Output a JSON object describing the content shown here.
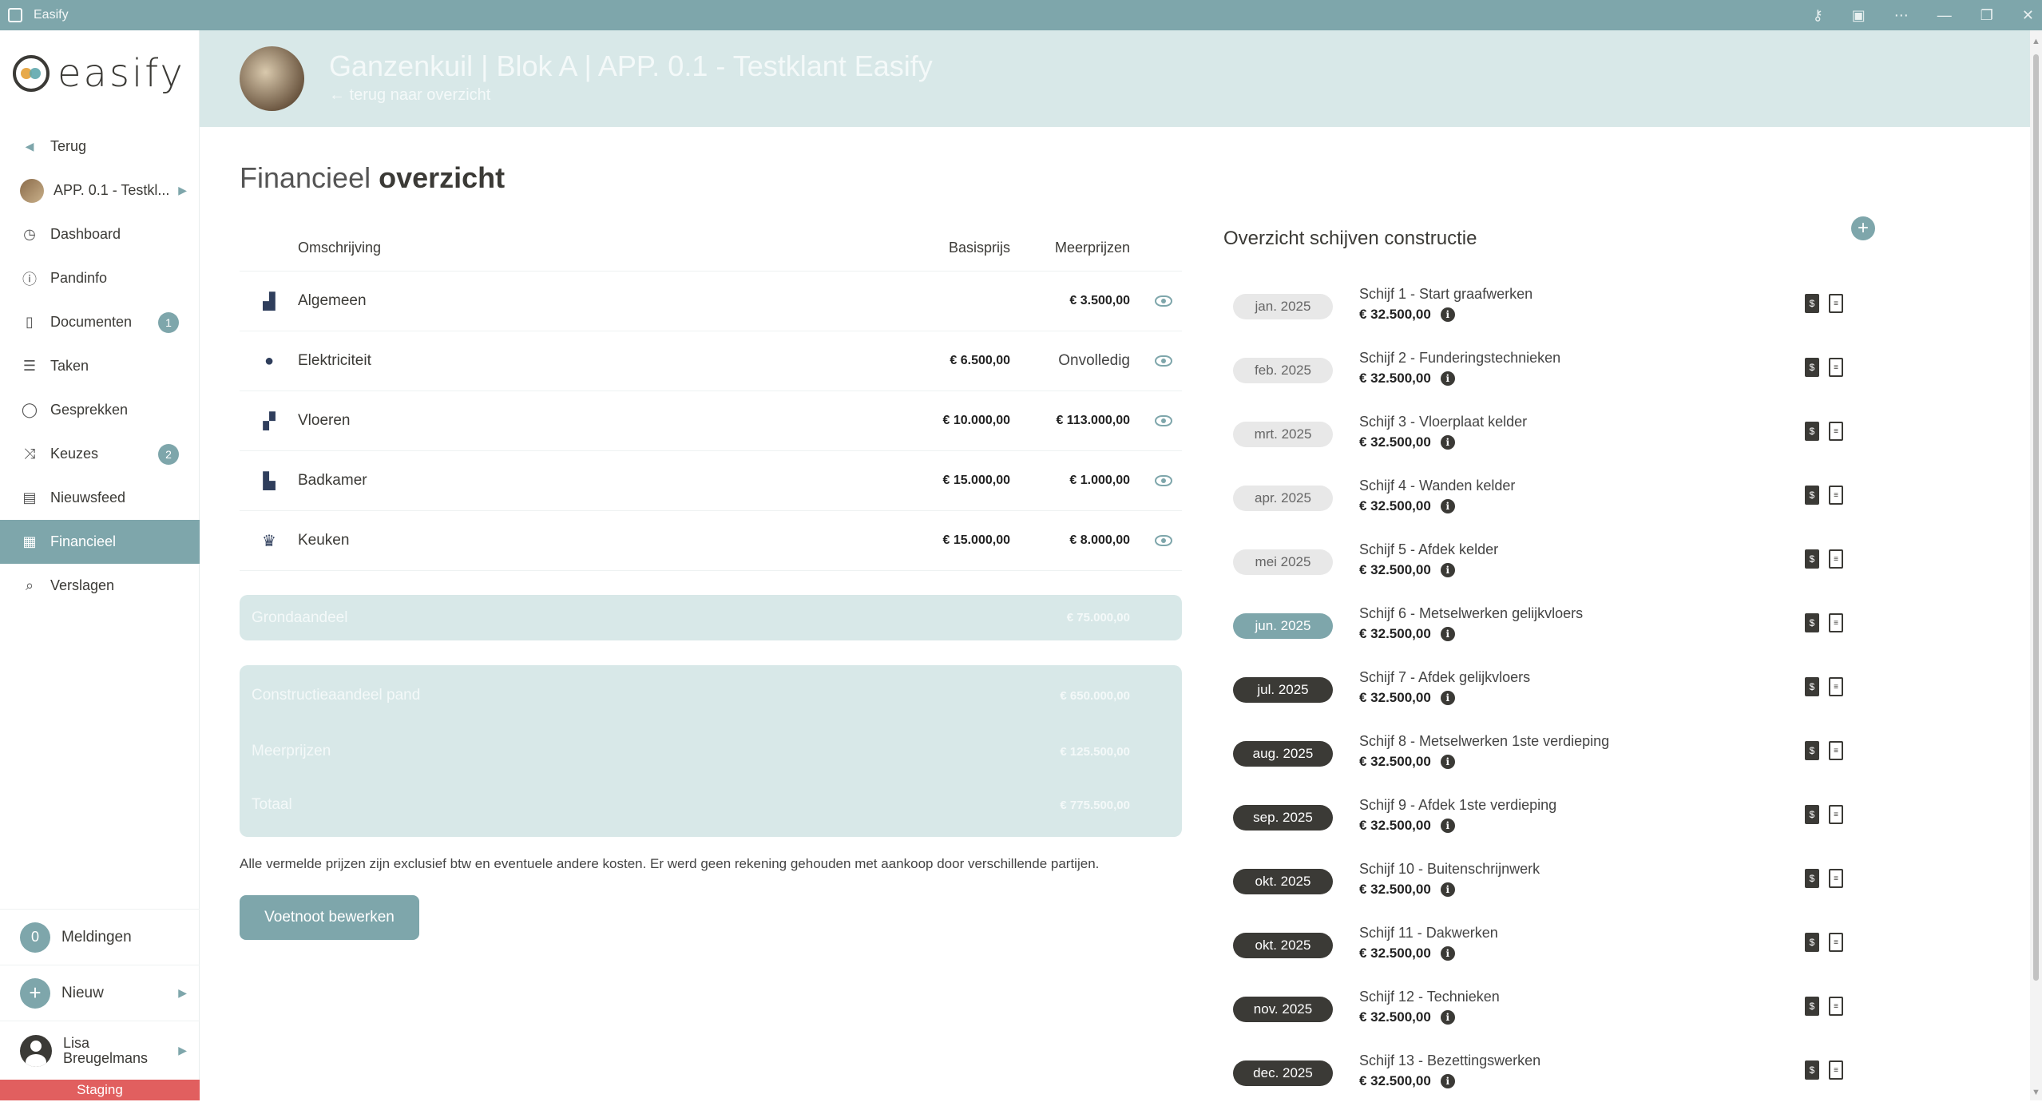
{
  "window": {
    "title": "Easify"
  },
  "sidebar": {
    "logo_text": "easify",
    "items": [
      {
        "label": "Terug",
        "icon": "caret-left-icon"
      },
      {
        "label": "APP. 0.1 - Testkl...",
        "icon": "project-avatar"
      },
      {
        "label": "Dashboard",
        "icon": "dashboard-icon"
      },
      {
        "label": "Pandinfo",
        "icon": "info-icon"
      },
      {
        "label": "Documenten",
        "icon": "document-icon",
        "badge": "1"
      },
      {
        "label": "Taken",
        "icon": "tasks-icon"
      },
      {
        "label": "Gesprekken",
        "icon": "chat-icon"
      },
      {
        "label": "Keuzes",
        "icon": "shuffle-icon",
        "badge": "2"
      },
      {
        "label": "Nieuwsfeed",
        "icon": "newsfeed-icon"
      },
      {
        "label": "Financieel",
        "icon": "finance-icon",
        "active": true
      },
      {
        "label": "Verslagen",
        "icon": "report-icon"
      }
    ],
    "notifications": {
      "count": "0",
      "label": "Meldingen"
    },
    "new": {
      "icon": "+",
      "label": "Nieuw"
    },
    "user": {
      "first": "Lisa",
      "last": "Breugelmans"
    },
    "environment": "Staging"
  },
  "header": {
    "title": "Ganzenkuil | Blok A | APP. 0.1 - Testklant Easify",
    "back_link": "← terug naar overzicht"
  },
  "page": {
    "title_light": "Financieel",
    "title_bold": "overzicht"
  },
  "fin_table": {
    "headers": {
      "description": "Omschrijving",
      "base": "Basisprijs",
      "extra": "Meerprijzen"
    },
    "rows": [
      {
        "icon": "building-icon",
        "description": "Algemeen",
        "base": "",
        "extra": "€ 3.500,00"
      },
      {
        "icon": "lightbulb-icon",
        "description": "Elektriciteit",
        "base": "€ 6.500,00",
        "extra": "Onvolledig"
      },
      {
        "icon": "floor-tiles-icon",
        "description": "Vloeren",
        "base": "€ 10.000,00",
        "extra": "€ 113.000,00"
      },
      {
        "icon": "bathtub-icon",
        "description": "Badkamer",
        "base": "€ 15.000,00",
        "extra": "€ 1.000,00"
      },
      {
        "icon": "chef-hat-icon",
        "description": "Keuken",
        "base": "€ 15.000,00",
        "extra": "€ 8.000,00"
      }
    ]
  },
  "summary": {
    "grond": {
      "label": "Grondaandeel",
      "value": "€ 75.000,00"
    },
    "constructie": {
      "label": "Constructieaandeel pand",
      "value": "€ 650.000,00"
    },
    "meerprijzen": {
      "label": "Meerprijzen",
      "value": "€ 125.500,00"
    },
    "totaal": {
      "label": "Totaal",
      "value": "€ 775.500,00"
    }
  },
  "footnote": "Alle vermelde prijzen zijn exclusief btw en eventuele andere kosten. Er werd geen rekening gehouden met aankoop door verschillende partijen.",
  "footnote_button": "Voetnoot bewerken",
  "schijven": {
    "title": "Overzicht schijven constructie",
    "add_icon": "+",
    "items": [
      {
        "date": "jan. 2025",
        "name": "Schijf 1 - Start graafwerken",
        "amount": "€ 32.500,00",
        "state": "past"
      },
      {
        "date": "feb. 2025",
        "name": "Schijf 2 - Funderingstechnieken",
        "amount": "€ 32.500,00",
        "state": "past"
      },
      {
        "date": "mrt. 2025",
        "name": "Schijf 3 - Vloerplaat kelder",
        "amount": "€ 32.500,00",
        "state": "past"
      },
      {
        "date": "apr. 2025",
        "name": "Schijf 4 - Wanden kelder",
        "amount": "€ 32.500,00",
        "state": "past"
      },
      {
        "date": "mei 2025",
        "name": "Schijf 5 - Afdek kelder",
        "amount": "€ 32.500,00",
        "state": "past"
      },
      {
        "date": "jun. 2025",
        "name": "Schijf 6 - Metselwerken gelijkvloers",
        "amount": "€ 32.500,00",
        "state": "current"
      },
      {
        "date": "jul. 2025",
        "name": "Schijf 7 - Afdek gelijkvloers",
        "amount": "€ 32.500,00",
        "state": "future"
      },
      {
        "date": "aug. 2025",
        "name": "Schijf 8 - Metselwerken 1ste verdieping",
        "amount": "€ 32.500,00",
        "state": "future"
      },
      {
        "date": "sep. 2025",
        "name": "Schijf 9 - Afdek 1ste verdieping",
        "amount": "€ 32.500,00",
        "state": "future"
      },
      {
        "date": "okt. 2025",
        "name": "Schijf 10 - Buitenschrijnwerk",
        "amount": "€ 32.500,00",
        "state": "future"
      },
      {
        "date": "okt. 2025",
        "name": "Schijf 11 - Dakwerken",
        "amount": "€ 32.500,00",
        "state": "future"
      },
      {
        "date": "nov. 2025",
        "name": "Schijf 12 - Technieken",
        "amount": "€ 32.500,00",
        "state": "future"
      },
      {
        "date": "dec. 2025",
        "name": "Schijf 13 - Bezettingswerken",
        "amount": "€ 32.500,00",
        "state": "future"
      }
    ]
  },
  "colors": {
    "accent": "#7ea6ab",
    "header_bg": "#d8e8e8",
    "dark": "#3b3a36",
    "staging": "#e15f5f"
  }
}
